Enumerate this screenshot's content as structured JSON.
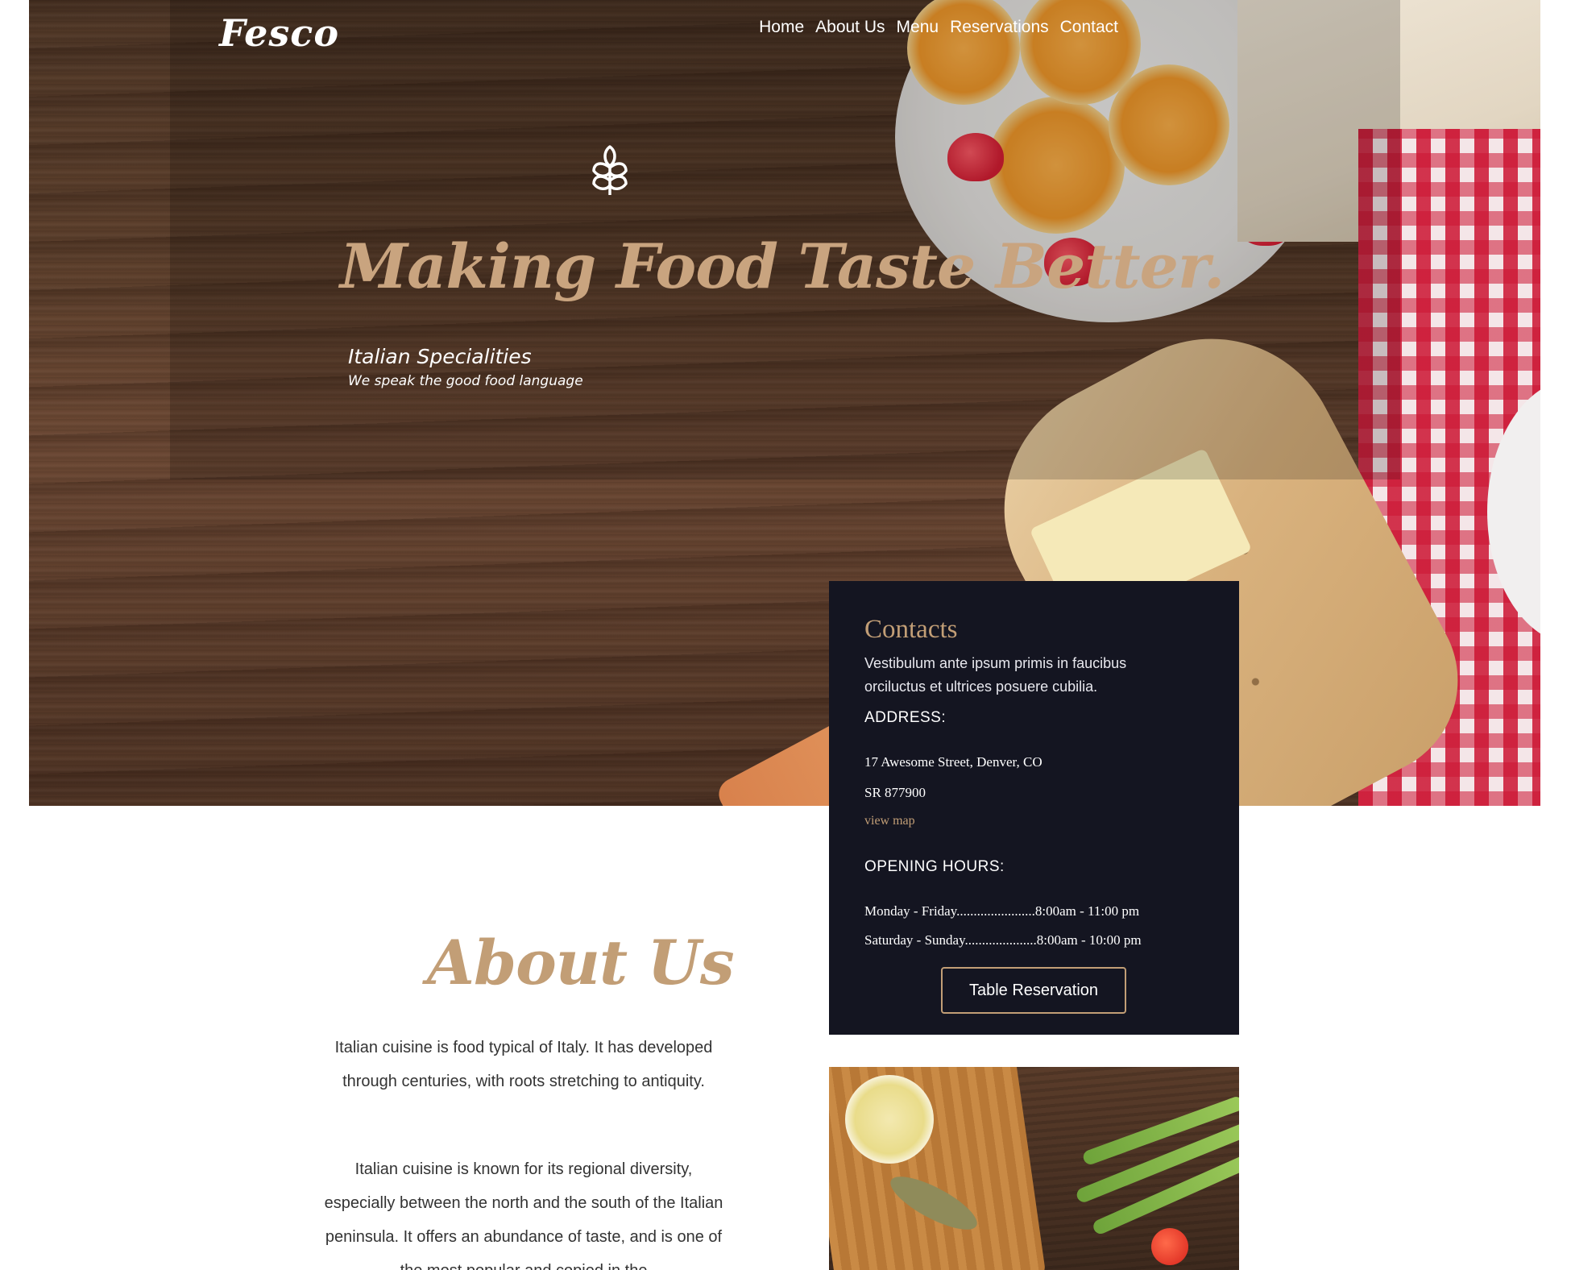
{
  "brand": {
    "logo": "Fesco"
  },
  "nav": {
    "items": [
      {
        "label": "Home"
      },
      {
        "label": "About Us"
      },
      {
        "label": "Menu"
      },
      {
        "label": "Reservations"
      },
      {
        "label": "Contact"
      }
    ]
  },
  "hero": {
    "icon": "wheat-leaf-icon",
    "headline": "Making Food Taste Better.",
    "subtitle": "Italian Specialities",
    "tagline": "We speak the good food language"
  },
  "contacts": {
    "title": "Contacts",
    "description": "Vestibulum ante ipsum primis in faucibus orciluctus et ultrices posuere cubilia.",
    "address_heading": "ADDRESS:",
    "address_line1": "17 Awesome Street, Denver, CO",
    "address_line2": "SR 877900",
    "map_link": "view map",
    "hours_heading": "OPENING HOURS:",
    "hours": [
      {
        "text": "Monday - Friday.......................8:00am - 11:00 pm"
      },
      {
        "text": "Saturday - Sunday.....................8:00am - 10:00 pm"
      }
    ],
    "button_label": "Table Reservation"
  },
  "about": {
    "title": "About Us",
    "paragraph1": "Italian cuisine is food typical of Italy. It has developed through centuries, with roots stretching to antiquity.",
    "paragraph2": "Italian cuisine is known for its regional diversity, especially between the north and the south of the Italian peninsula. It offers an abundance of taste, and is one of the most popular and copied in the"
  },
  "colors": {
    "accent": "#c29e76",
    "card_bg": "#141521",
    "text_dark": "#333333"
  }
}
